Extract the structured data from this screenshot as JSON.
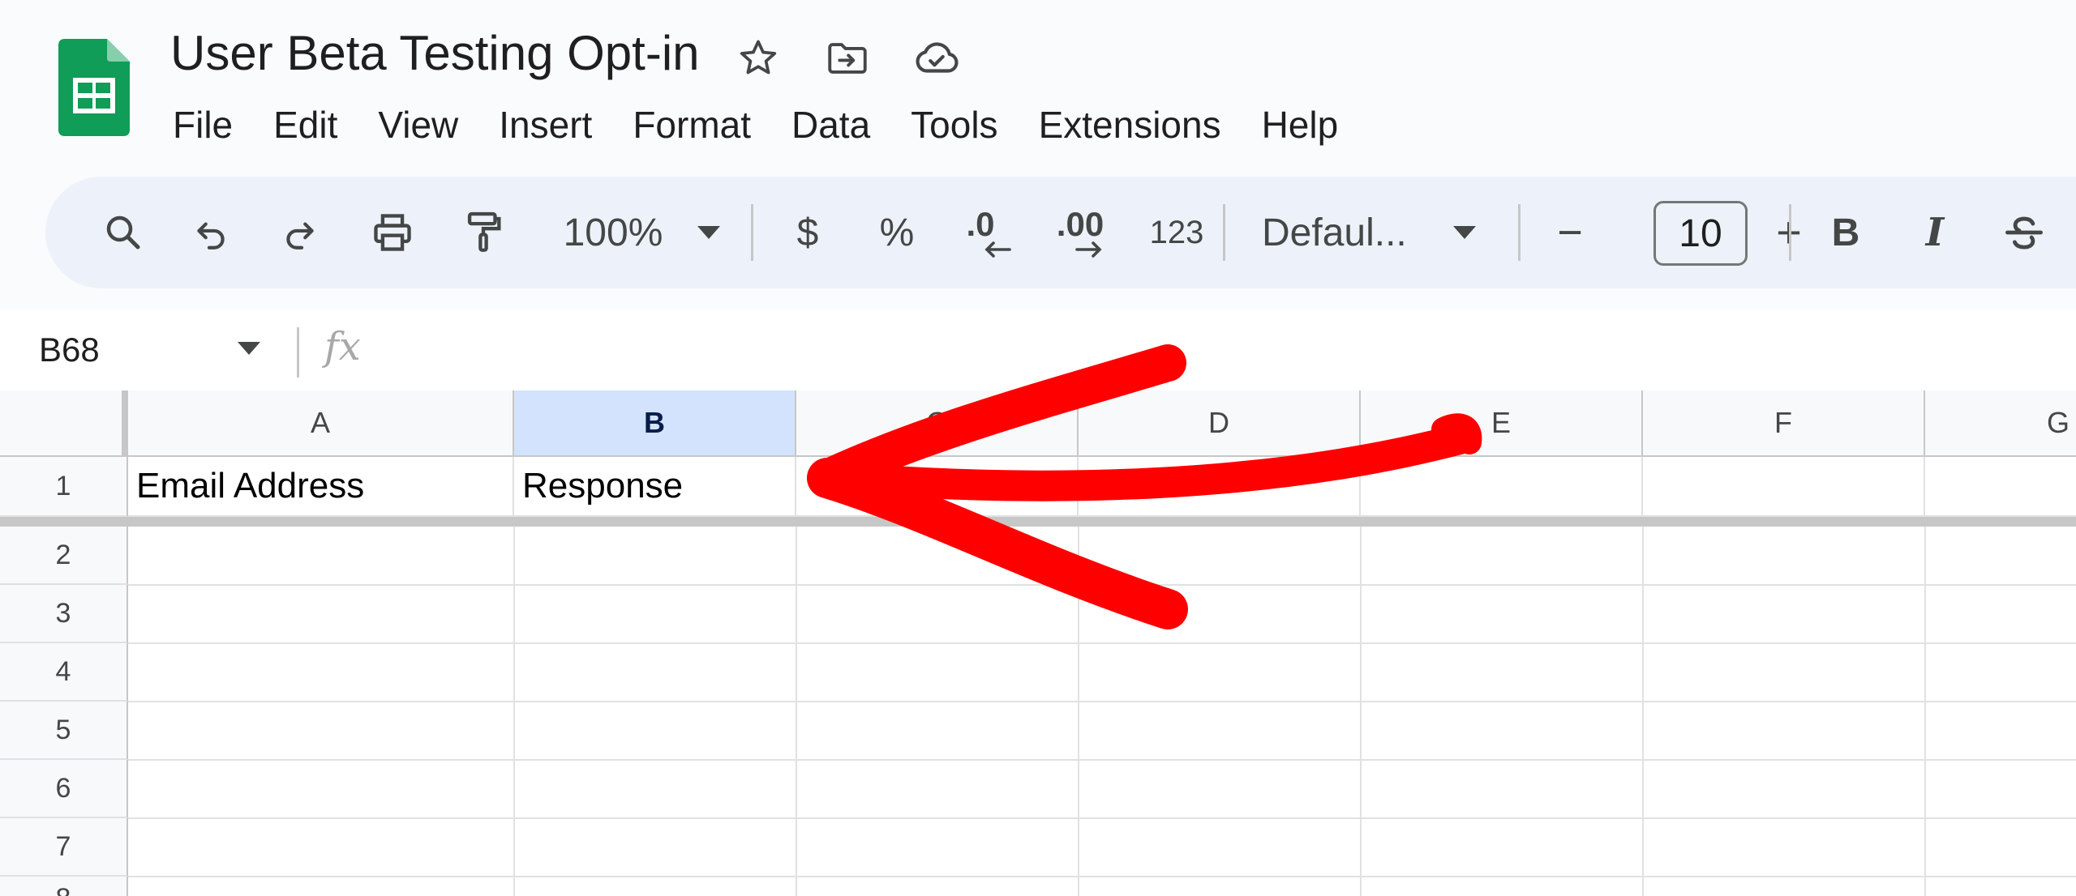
{
  "app": {
    "doc_title": "User Beta Testing Opt-in",
    "brand_color": "#0f9d58"
  },
  "menu": [
    "File",
    "Edit",
    "View",
    "Insert",
    "Format",
    "Data",
    "Tools",
    "Extensions",
    "Help"
  ],
  "toolbar": {
    "zoom": "100%",
    "currency": "$",
    "percent": "%",
    "decrease_decimal": ".0",
    "increase_decimal": ".00",
    "number_format": "123",
    "font": "Defaul...",
    "font_size": "10",
    "decrease_font": "−",
    "increase_font": "+",
    "bold": "B",
    "italic": "I"
  },
  "formula_bar": {
    "name_box": "B68",
    "fx": "fx",
    "formula": ""
  },
  "grid": {
    "columns": [
      "A",
      "B",
      "C",
      "D",
      "E",
      "F",
      "G"
    ],
    "selected_column": "B",
    "rows": [
      "1",
      "2",
      "3",
      "4",
      "5",
      "6",
      "7",
      "8"
    ],
    "cells": {
      "A1": "Email Address",
      "B1": "Response"
    }
  },
  "annotation": {
    "type": "red-arrow",
    "color": "#ff0000"
  }
}
